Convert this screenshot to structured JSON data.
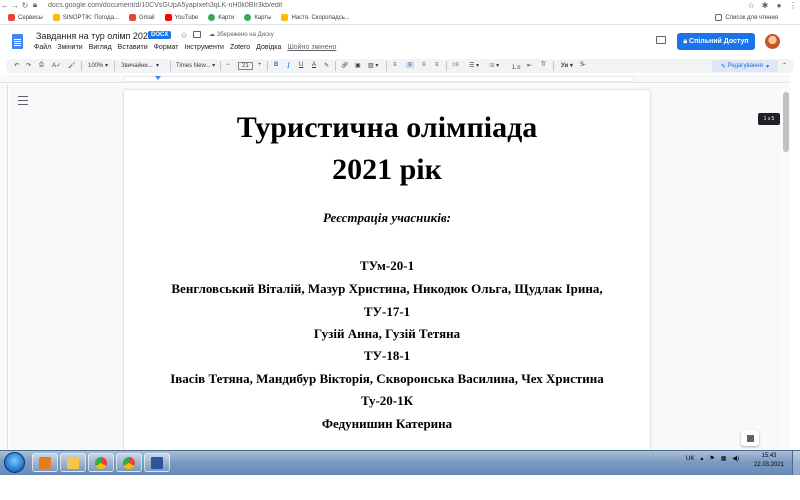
{
  "browser": {
    "url": "docs.google.com/document/d/10CVsGUpA5yapIxeh3qLK-nH0k0BIr3kb/edit",
    "bookmarks": [
      {
        "label": "Сервисы",
        "color": "#ea4335"
      },
      {
        "label": "SINOPTIK: Погода...",
        "color": "#fbbc05"
      },
      {
        "label": "Gmail",
        "color": "#ea4335"
      },
      {
        "label": "YouTube",
        "color": "#ff0000"
      },
      {
        "label": "Карти",
        "color": "#34a853"
      },
      {
        "label": "Карты",
        "color": "#34a853"
      },
      {
        "label": "Настя. Скоропадсь...",
        "color": "#fbbc05"
      }
    ],
    "reading_list": "Список для чтения"
  },
  "docs": {
    "title": "Завдання на тур олімп 2021",
    "badge": "DOCX",
    "saved": "Збережено на Диску",
    "menu": [
      "Файл",
      "Змінити",
      "Вигляд",
      "Вставити",
      "Формат",
      "Інструменти",
      "Zotero",
      "Довідка"
    ],
    "last_edit": "Шойно змінено",
    "share_label": "Спільний Доступ",
    "accent_color": "#1a73e8"
  },
  "toolbar": {
    "zoom": "100%",
    "style": "Звичайни...",
    "font": "Times New...",
    "font_size": "21",
    "bold": "B",
    "italic": "I",
    "underline": "U",
    "text_color": "A",
    "mode": "Редагування"
  },
  "document": {
    "title_line1": "Туристична олімпіада",
    "title_line2": "2021 рік",
    "registration": "Реєстрація учасників:",
    "lines": [
      "ТУм-20-1",
      "Венгловський Віталій, Мазур Христина, Никодюк Ольга, Щудлак Ірина,",
      "ТУ-17-1",
      "Гузій Анна, Гузій Тетяна",
      "ТУ-18-1",
      "Івасів Тетяна, Мандибур Вікторія, Скворонська Василина, Чех Христина",
      "Ту-20-1К",
      "Федунишин Катерина"
    ],
    "page_indicator": "1 з 5"
  },
  "taskbar": {
    "lang": "UK",
    "time": "15:43",
    "date": "22.03.2021"
  }
}
